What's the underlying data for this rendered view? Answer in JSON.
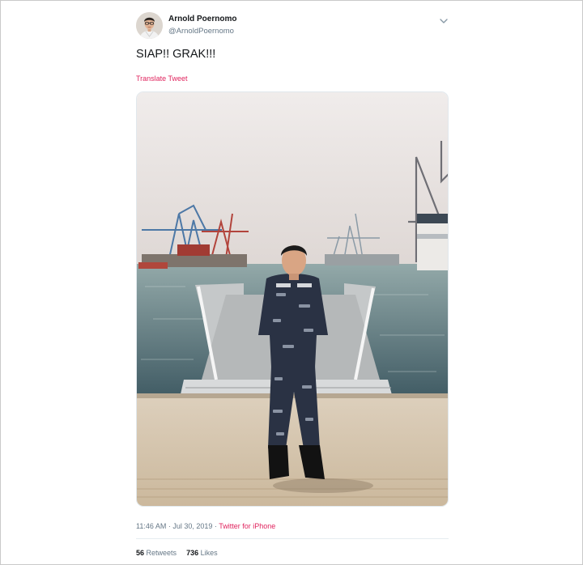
{
  "author": {
    "name": "Arnold Poernomo",
    "handle": "@ArnoldPoernomo"
  },
  "tweet": {
    "text": "SIAP!! GRAK!!!",
    "translate_label": "Translate Tweet",
    "time": "11:46 AM · Jul 30, 2019",
    "separator": " · ",
    "source": "Twitter for iPhone"
  },
  "stats": {
    "retweets_count": "56",
    "retweets_label": "Retweets",
    "likes_count": "736",
    "likes_label": "Likes"
  },
  "icons": {
    "caret": "chevron-down-icon"
  },
  "colors": {
    "accent": "#e0245e",
    "secondary_text": "#657786",
    "primary_text": "#14171a"
  }
}
